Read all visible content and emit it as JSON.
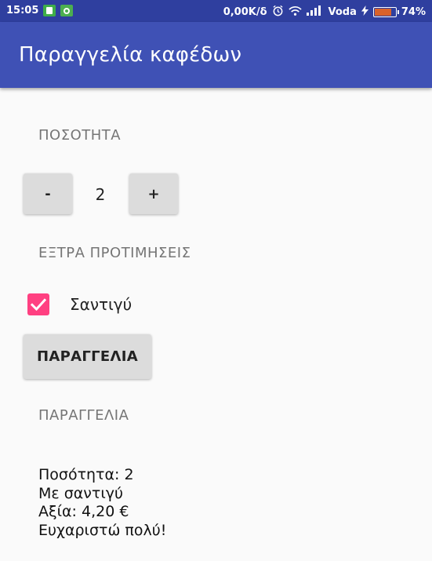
{
  "status_bar": {
    "time": "15:05",
    "network_speed": "0,00K/δ",
    "carrier": "Voda",
    "battery_percent": "74%",
    "battery_level": 0.74,
    "icons": [
      "sim-card-icon",
      "android-icon",
      "alarm-icon",
      "wifi-icon",
      "signal-icon",
      "charging-icon",
      "battery-icon"
    ]
  },
  "app_bar": {
    "title": "Παραγγελία καφέδων"
  },
  "quantity": {
    "label": "ΠΟΣΟΤΗΤΑ",
    "decrement_label": "-",
    "increment_label": "+",
    "value": "2"
  },
  "extras": {
    "label": "ΕΞΤΡΑ ΠΡΟΤΙΜΗΣΕΙΣ",
    "whipped_cream_label": "Σαντιγύ",
    "whipped_cream_checked": true
  },
  "order_button": {
    "label": "ΠΑΡΑΓΓΕΛΙΑ"
  },
  "summary": {
    "label": "ΠΑΡΑΓΓΕΛΙΑ",
    "lines": [
      "Ποσότητα: 2",
      "Με σαντιγύ",
      "Αξία: 4,20 €",
      "Ευχαριστώ πολύ!"
    ]
  },
  "colors": {
    "primary": "#3f51b5",
    "primary_dark": "#2f3f9f",
    "accent": "#ff4081",
    "button": "#dcdcdc",
    "background": "#fafafa"
  }
}
